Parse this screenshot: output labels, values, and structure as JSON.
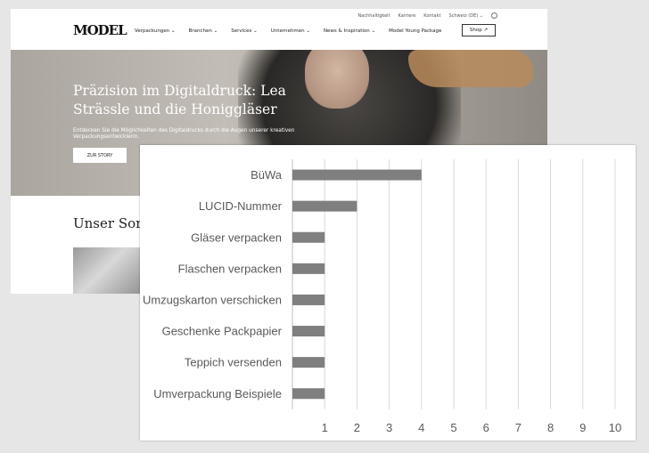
{
  "site": {
    "logo": "MODEL",
    "utility_nav": [
      "Nachhaltigkeit",
      "Karriere",
      "Kontakt",
      "Schweiz (DE) ⌄"
    ],
    "main_nav": [
      "Verpackungen ⌄",
      "Branchen ⌄",
      "Services ⌄",
      "Unternehmen ⌄",
      "News & Inspiration ⌄",
      "Model Young Package"
    ],
    "shop_label": "Shop ↗",
    "hero": {
      "title": "Präzision im Digitaldruck: Lea Strässle und die Honiggläser",
      "subtitle": "Entdecken Sie die Möglichkeiten des Digitaldrucks durch die Augen unserer kreativen Verpackungsentwicklerin.",
      "button": "ZUR STORY"
    },
    "section_heading": "Unser Sor"
  },
  "colors": {
    "bar": "#7f7f7f",
    "grid": "#d9d9d9",
    "axis": "#bfbfbf",
    "label": "#595959"
  },
  "chart_data": {
    "type": "bar",
    "orientation": "horizontal",
    "categories": [
      "BüWa",
      "LUCID-Nummer",
      "Gläser verpacken",
      "Flaschen verpacken",
      "Umzugskarton verschicken",
      "Geschenke Packpapier",
      "Teppich versenden",
      "Umverpackung Beispiele"
    ],
    "values": [
      4,
      2,
      1,
      1,
      1,
      1,
      1,
      1
    ],
    "xlim": [
      0,
      10
    ],
    "xticks": [
      1,
      2,
      3,
      4,
      5,
      6,
      7,
      8,
      9,
      10
    ],
    "grid": true,
    "legend": "none"
  }
}
